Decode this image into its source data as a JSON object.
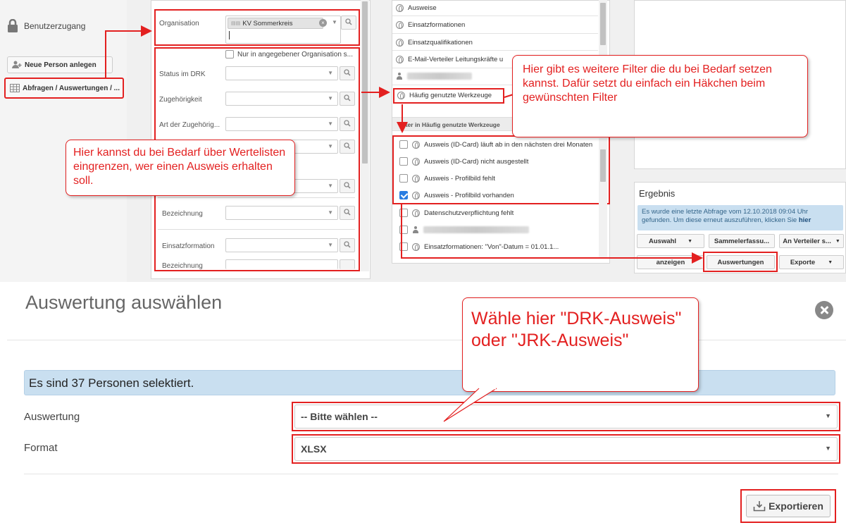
{
  "app": {
    "sidebar": {
      "user_access_label": "Benutzerzugang",
      "new_person_label": "Neue Person anlegen",
      "queries_label": "Abfragen / Auswertungen / ..."
    },
    "filters": {
      "organisation_label": "Organisation",
      "organisation_tag": "KV Sommerkreis",
      "only_in_org_label": "Nur in angegebener Organisation s...",
      "status_label": "Status im DRK",
      "zugehoerigkeit_label": "Zugehörigkeit",
      "art_label": "Art der Zugehörig...",
      "bezeichnung_label": "Bezeichnung",
      "einsatzformation_label": "Einsatzformation",
      "bezeichnung2_label": "Bezeichnung"
    },
    "tools_list": {
      "items": [
        "Ausweise",
        "Einsatzformationen",
        "Einsatzqualifikationen",
        "E-Mail-Verteiler Leitungskräfte u",
        "Häufig genutzte Werkzeuge"
      ],
      "section_header": "ilter in Häufig genutzte Werkzeuge"
    },
    "filter_list": {
      "items": [
        {
          "label": "Ausweis (ID-Card) läuft ab in den nächsten drei Monaten",
          "checked": false
        },
        {
          "label": "Ausweis (ID-Card) nicht ausgestellt",
          "checked": false
        },
        {
          "label": "Ausweis - Profilbild fehlt",
          "checked": false
        },
        {
          "label": "Ausweis - Profilbild vorhanden",
          "checked": true
        },
        {
          "label": "Datenschutzverpflichtung fehlt",
          "checked": false
        },
        {
          "label": "Einsatzformationen: \"Von\"-Datum = 01.01.1...",
          "checked": false
        }
      ]
    },
    "result": {
      "title": "Ergebnis",
      "info_text": "Es wurde eine letzte Abfrage vom 12.10.2018 09:04 Uhr gefunden. Um diese erneut auszuführen, klicken Sie ",
      "info_link": "hier",
      "buttons_row1": [
        "Auswahl",
        "Sammelerfassu...",
        "An Verteiler s..."
      ],
      "buttons_row2": [
        "anzeigen",
        "Auswertungen",
        "Exporte"
      ]
    },
    "callouts": {
      "filters_hint": "Hier gibt es weitere Filter die du bei Bedarf setzen kannst. Dafür setzt du einfach ein Häkchen beim gewünschten Filter",
      "lists_hint": "Hier kannst du bei Bedarf über Wertelisten eingrenzen, wer einen Ausweis erhalten soll.",
      "choose_hint": "Wähle hier \"DRK-Ausweis\" oder \"JRK-Ausweis\""
    },
    "colors": {
      "annotation_red": "#e32020",
      "alert_blue": "#c9dff0",
      "checkbox_blue": "#2a7de1"
    }
  },
  "modal": {
    "title": "Auswertung auswählen",
    "alert": "Es sind 37 Personen selektiert.",
    "auswertung_label": "Auswertung",
    "auswertung_value": "-- Bitte wählen --",
    "format_label": "Format",
    "format_value": "XLSX",
    "export_label": "Exportieren"
  }
}
